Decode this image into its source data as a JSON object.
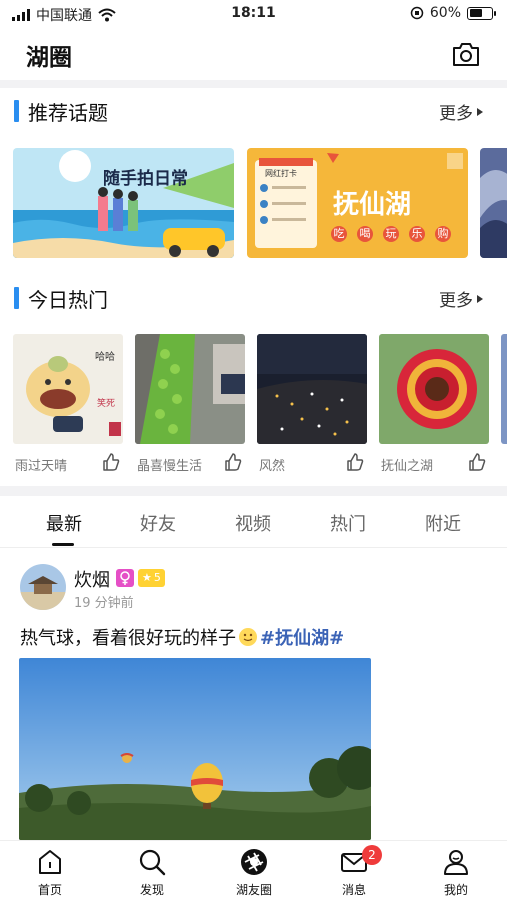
{
  "status_bar": {
    "carrier": "中国联通",
    "time": "18:11",
    "battery": "60%",
    "battery_level": 0.6
  },
  "header": {
    "title": "湖圈",
    "camera_icon": "camera-icon"
  },
  "topics": {
    "title": "推荐话题",
    "more": "更多",
    "cards": [
      {
        "title": "随手拍日常"
      },
      {
        "title": "抚仙湖",
        "tags": [
          "吃",
          "喝",
          "玩",
          "乐",
          "购"
        ],
        "note": "网红打卡"
      },
      {
        "title": ""
      }
    ]
  },
  "hot": {
    "title": "今日热门",
    "more": "更多",
    "items": [
      {
        "name": "雨过天晴",
        "sticker": "哈哈"
      },
      {
        "name": "晶喜慢生活"
      },
      {
        "name": "风然"
      },
      {
        "name": "抚仙之湖"
      }
    ]
  },
  "feed_tabs": {
    "items": [
      "最新",
      "好友",
      "视频",
      "热门",
      "附近"
    ],
    "active": "最新"
  },
  "post": {
    "author": "炊烟",
    "level": "5",
    "time": "19 分钟前",
    "text": "热气球，看着很好玩的样子",
    "hashtag": "#抚仙湖#"
  },
  "tabbar": {
    "items": [
      {
        "label": "首页",
        "icon": "home-icon"
      },
      {
        "label": "发现",
        "icon": "search-icon"
      },
      {
        "label": "湖友圈",
        "icon": "aperture-icon"
      },
      {
        "label": "消息",
        "icon": "mail-icon",
        "badge": "2"
      },
      {
        "label": "我的",
        "icon": "user-icon"
      }
    ]
  },
  "colors": {
    "accent": "#2a8ef0",
    "hashtag": "#3b63b6",
    "badge": "#ef3b3b",
    "level_badge": "#ffd233",
    "gender_badge": "#e54fc6"
  }
}
